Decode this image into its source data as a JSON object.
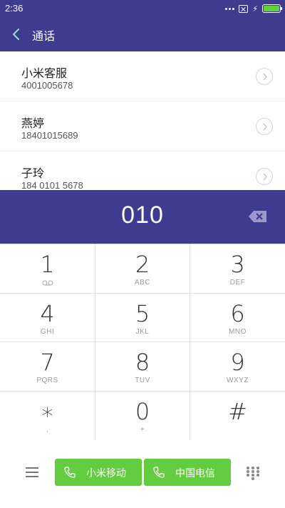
{
  "status_bar": {
    "time": "2:36"
  },
  "header": {
    "title": "通话"
  },
  "contacts": [
    {
      "name": "小米客服",
      "number": "4001005678"
    },
    {
      "name": "燕婷",
      "number": "18401015689"
    },
    {
      "name": "子玲",
      "number": "184 0101 5678"
    }
  ],
  "dial": {
    "entered": "010"
  },
  "keys": [
    {
      "digit": "1",
      "letters": ""
    },
    {
      "digit": "2",
      "letters": "ABC"
    },
    {
      "digit": "3",
      "letters": "DEF"
    },
    {
      "digit": "4",
      "letters": "GHI"
    },
    {
      "digit": "5",
      "letters": "JKL"
    },
    {
      "digit": "6",
      "letters": "MNO"
    },
    {
      "digit": "7",
      "letters": "PQRS"
    },
    {
      "digit": "8",
      "letters": "TUV"
    },
    {
      "digit": "9",
      "letters": "WXYZ"
    },
    {
      "digit": "∗",
      "letters": ","
    },
    {
      "digit": "0",
      "letters": "+"
    },
    {
      "digit": "#",
      "letters": ""
    }
  ],
  "call_buttons": {
    "sim1": "小米移动",
    "sim2": "中国电信"
  },
  "colors": {
    "primary": "#3e3c8e",
    "call_green": "#64cc41",
    "battery_green": "#5fd33a"
  },
  "icons": [
    "back-icon",
    "chevron-right-icon",
    "backspace-icon",
    "voicemail-icon",
    "phone-icon",
    "menu-icon",
    "dialpad-icon",
    "battery-icon",
    "no-sim-icon",
    "charging-icon"
  ]
}
